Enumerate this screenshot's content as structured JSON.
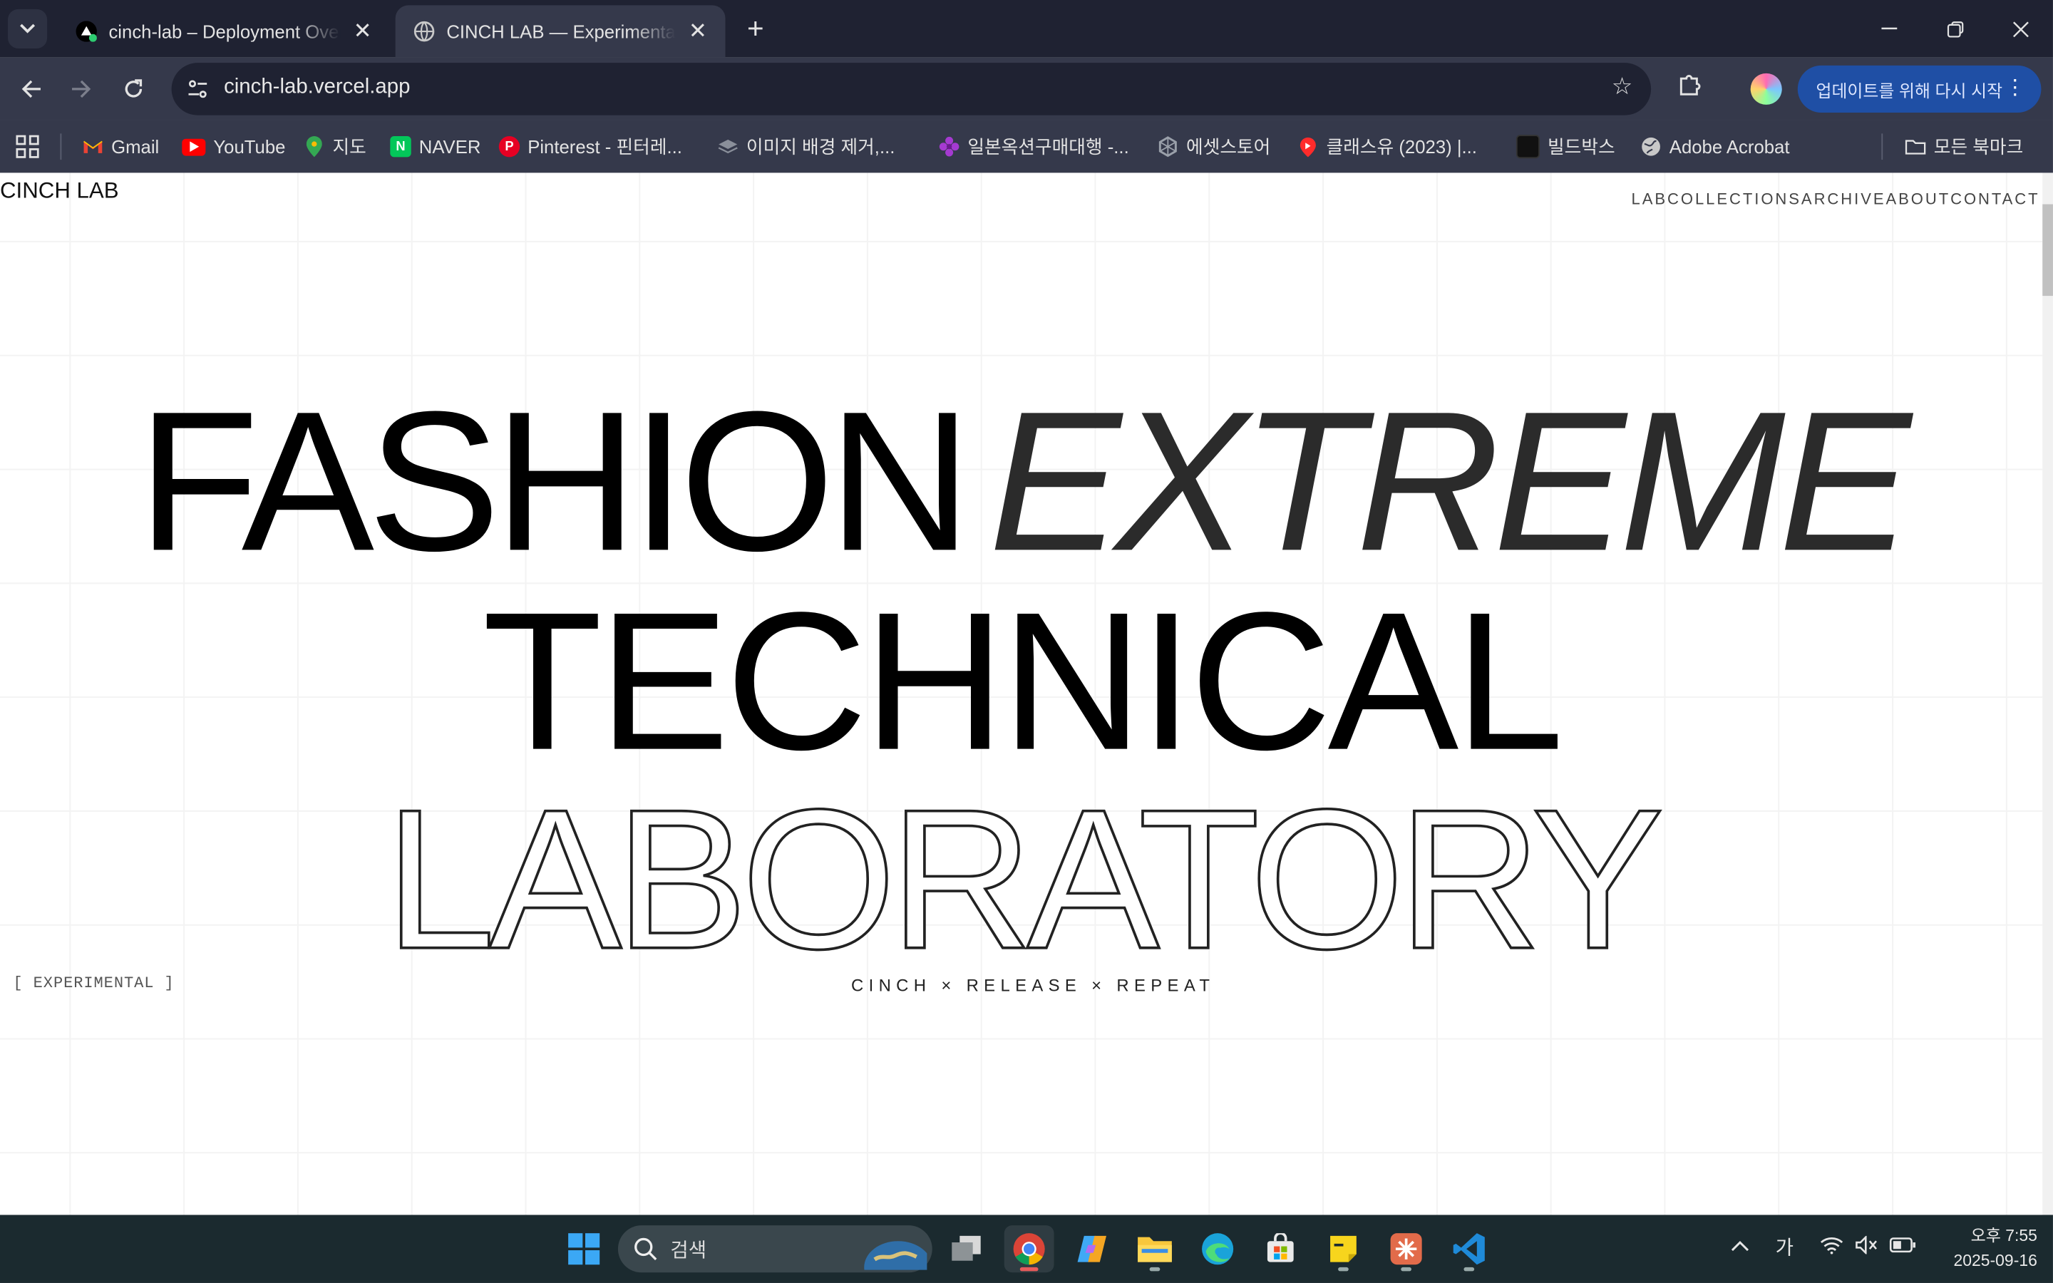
{
  "browser": {
    "tabs": [
      {
        "title": "cinch-lab – Deployment Overview",
        "active": false
      },
      {
        "title": "CINCH LAB — Experimental Fashion",
        "active": true
      }
    ],
    "url": "cinch-lab.vercel.app",
    "update_button": "업데이트를 위해 다시 시작",
    "bookmarks": [
      {
        "label": "Gmail",
        "icon": "gmail-icon"
      },
      {
        "label": "YouTube",
        "icon": "youtube-icon"
      },
      {
        "label": "지도",
        "icon": "maps-icon"
      },
      {
        "label": "NAVER",
        "icon": "naver-icon"
      },
      {
        "label": "Pinterest - 핀터레...",
        "icon": "pinterest-icon"
      },
      {
        "label": "이미지 배경 제거,...",
        "icon": "layers-icon"
      },
      {
        "label": "일본옥션구매대행 -...",
        "icon": "flower-icon"
      },
      {
        "label": "에셋스토어",
        "icon": "unity-icon"
      },
      {
        "label": "클래스유 (2023) |...",
        "icon": "classu-icon"
      },
      {
        "label": "빌드박스",
        "icon": "buildbox-icon"
      },
      {
        "label": "Adobe Acrobat",
        "icon": "globe-icon"
      }
    ],
    "all_bookmarks": "모든 북마크"
  },
  "site": {
    "logo": "CINCH LAB",
    "nav": [
      "LAB",
      "COLLECTIONS",
      "ARCHIVE",
      "ABOUT",
      "CONTACT"
    ],
    "hero": {
      "line1_a": "FASHION",
      "line1_b": "EXTREME",
      "line2": "TECHNICAL",
      "line3": "LABORATORY"
    },
    "tagline": "CINCH × RELEASE × REPEAT",
    "side_label": "[ EXPERIMENTAL ]"
  },
  "taskbar": {
    "search_placeholder": "검색",
    "ime": "가",
    "time": "오후 7:55",
    "date": "2025-09-16"
  },
  "colors": {
    "tab_bar": "#1f2232",
    "toolbar": "#35394b",
    "update_btn": "#1f4fa5",
    "taskbar": "#1b2a2f"
  }
}
